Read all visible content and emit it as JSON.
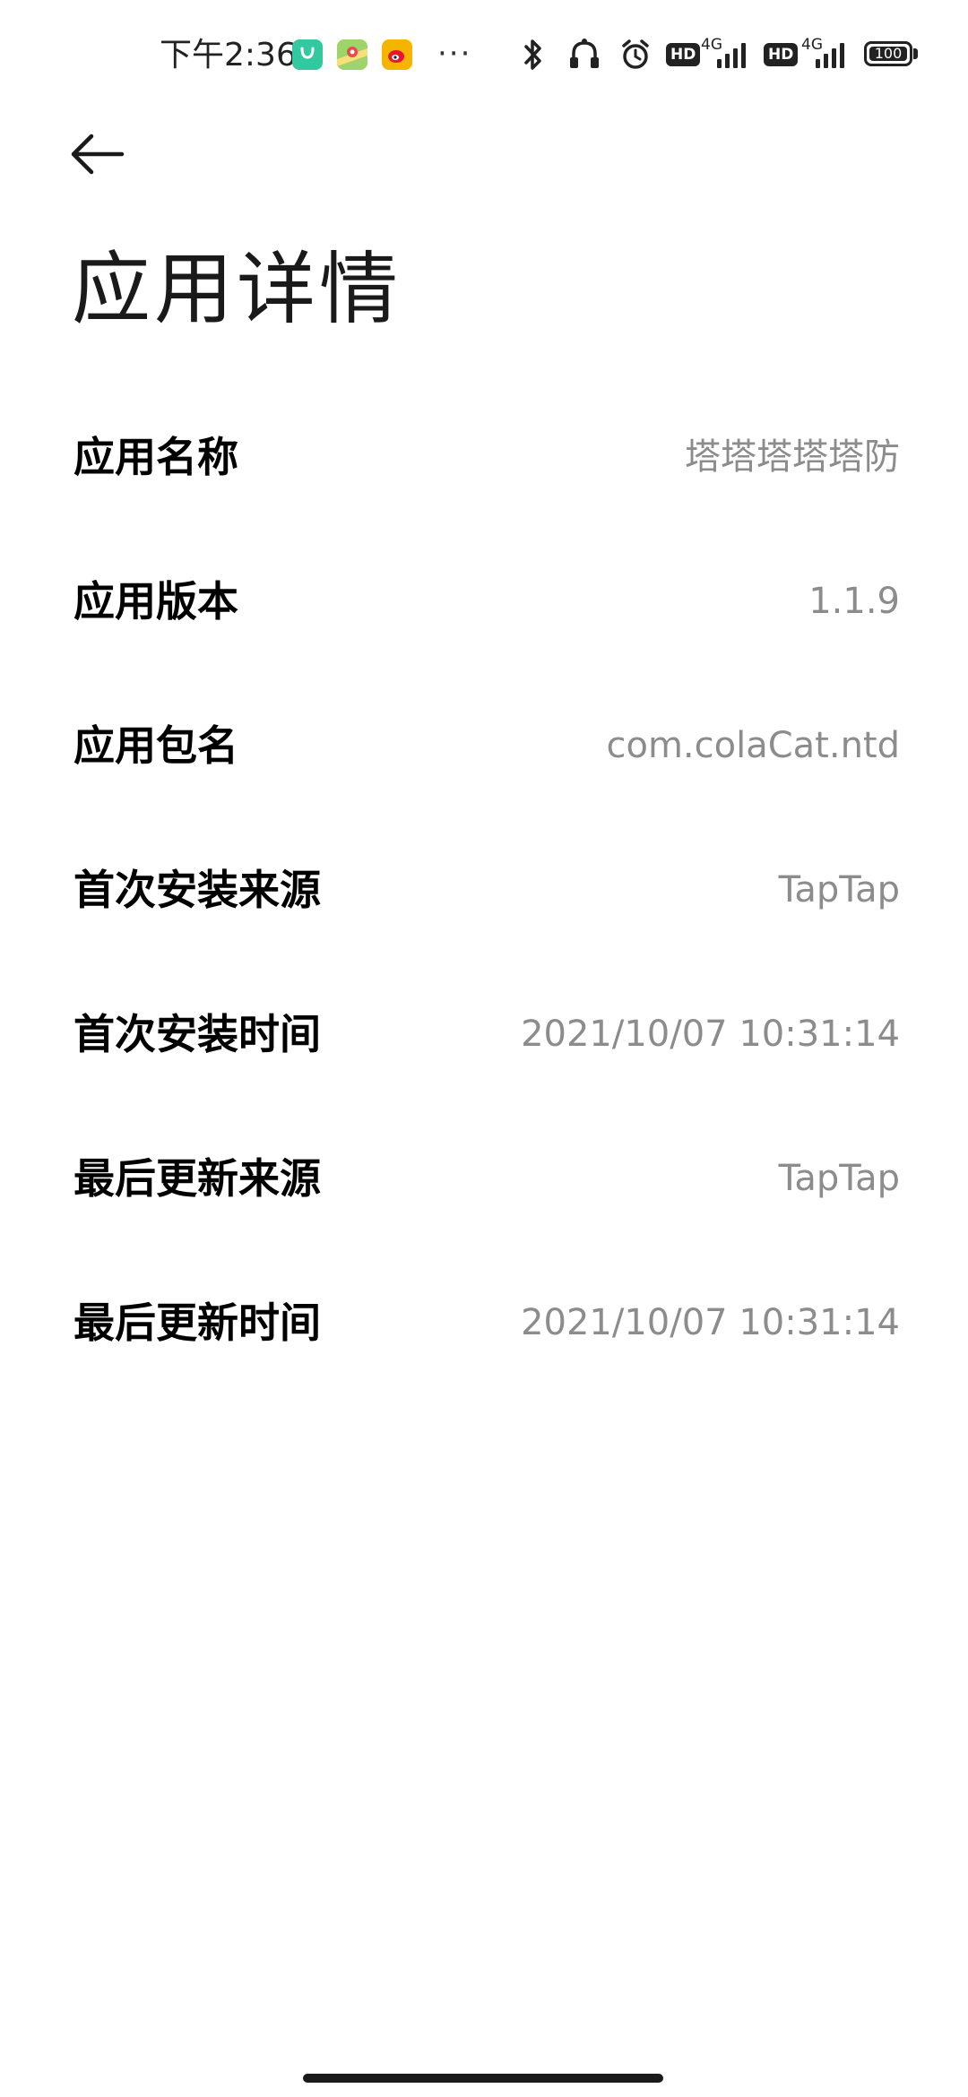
{
  "status_bar": {
    "time": "下午2:36",
    "more_dots": "···",
    "hd_label_1": "HD",
    "net_label_1": "4G",
    "hd_label_2": "HD",
    "net_label_2": "4G",
    "battery_level": "100",
    "icons": [
      "shopping-bag-app-icon",
      "maps-app-icon",
      "weibo-app-icon",
      "bluetooth-icon",
      "headset-icon",
      "alarm-icon",
      "signal-icon"
    ],
    "colors": {
      "shopping_app": "#33c9a0",
      "maps_app": "#f5c84a",
      "weibo_app": "#f4b400"
    }
  },
  "header": {
    "back_icon": "arrow-left-icon",
    "title": "应用详情"
  },
  "details": {
    "rows": [
      {
        "label": "应用名称",
        "value": "塔塔塔塔塔防"
      },
      {
        "label": "应用版本",
        "value": "1.1.9"
      },
      {
        "label": "应用包名",
        "value": "com.colaCat.ntd"
      },
      {
        "label": "首次安装来源",
        "value": "TapTap"
      },
      {
        "label": "首次安装时间",
        "value": "2021/10/07 10:31:14"
      },
      {
        "label": "最后更新来源",
        "value": "TapTap"
      },
      {
        "label": "最后更新时间",
        "value": "2021/10/07 10:31:14"
      }
    ]
  }
}
